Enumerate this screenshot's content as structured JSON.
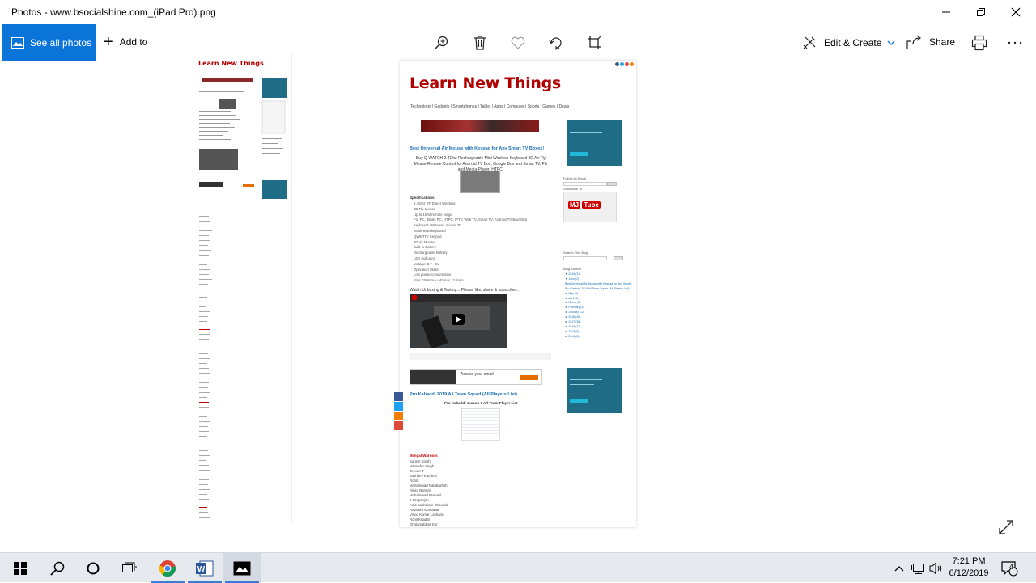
{
  "window": {
    "title": "Photos - www.bsocialshine.com_(iPad Pro).png"
  },
  "commandbar": {
    "see_all": "See all photos",
    "add_to": "Add to",
    "edit_create": "Edit & Create",
    "share": "Share",
    "tools": [
      "zoom-icon",
      "delete-icon",
      "favorite-icon",
      "rotate-icon",
      "crop-icon"
    ],
    "accent": "#0a74d9"
  },
  "webpage": {
    "logo": "Learn New Things",
    "nav": "Technology | Gadgets | Smartphones | Tablet | Apps | Computer | Sports | Games | Deals",
    "post_title": "Best Universal Air Mouse with Keypad for Any Smart TV Boxes!",
    "post_desc": "Buy Q-WATCH 2.4Ghz Rechargeable Mini Wireless Keyboard 3D Air Fly Mouse Remote Control for Android TV Box, Google Box and Smart TV, Fly and Media Player, HTPC.",
    "specs_heading": "Specifications:",
    "specs": [
      "2.4GHz RF Direct Wireless",
      "3D Fly Mouse",
      "Up to 10 M remote range",
      "For PC, Tablet PC, HTPC, IPTV, Web TV, Smart TV, Android TV Box/Stick",
      "Keyboard / Wireless mouse 3D",
      "Multimedia keyboard",
      "QWERTY Keypad",
      "3D Air Mouse",
      "Built-in Battery",
      "Rechargeable Battery",
      "LED Indicator",
      "Voltage: 3.7 - 5V",
      "Operation Mode",
      "Low power consumption",
      "Size: 150mm x 44mm x 13.5mm"
    ],
    "video_caption": "Watch Unboxing & Testing... Please like, share & subscribe...",
    "ad_text": "Access your email",
    "post2_title": "Pro Kabaddi 2019 All Team Squad (All Players List)",
    "post2_sub": "Pro Kabaddi season 7 All Team Player List",
    "team_heading": "Bengal Warriors",
    "team": [
      "Surjeet Singh",
      "Maninder Singh",
      "Jeevan T",
      "Sukhdev Kamboh",
      "Rohit",
      "Mohammad Nabibakhsh",
      "Rinku Narwal",
      "Mohammad Esmaeil",
      "K Prapanjan",
      "Amit Sakharam Dhaunde",
      "Ravindra Kumawat",
      "Vinod Kumar Lakhara",
      "Rohit Khadar",
      "Gholamabbas Kor"
    ],
    "side_follow": "Follow by Email",
    "side_subscribe": "Subscribe To",
    "channel": "MJ",
    "channel_tube": "Tube",
    "side_search": "Search This Blog",
    "side_archive": "Blog Archive",
    "archive": [
      "▼ 2019 (31)",
      "▼ June (2)",
      "Best Universal Air Mouse with Keypad for Any Smart...",
      "Pro Kabaddi 2019 All Team Squad (All Players List)",
      "► May (5)",
      "► April (4)",
      "► March (3)",
      "► February (4)",
      "► January (13)",
      "► 2018 (45)",
      "► 2017 (38)",
      "► 2016 (22)",
      "► 2015 (8)",
      "► 2014 (6)"
    ]
  },
  "taskbar": {
    "time": "7:21 PM",
    "date": "6/12/2019",
    "notifications": "4",
    "apps": [
      "start-icon",
      "search-icon",
      "cortana-icon",
      "task-view-icon",
      "chrome-icon",
      "word-icon",
      "photos-icon"
    ]
  }
}
